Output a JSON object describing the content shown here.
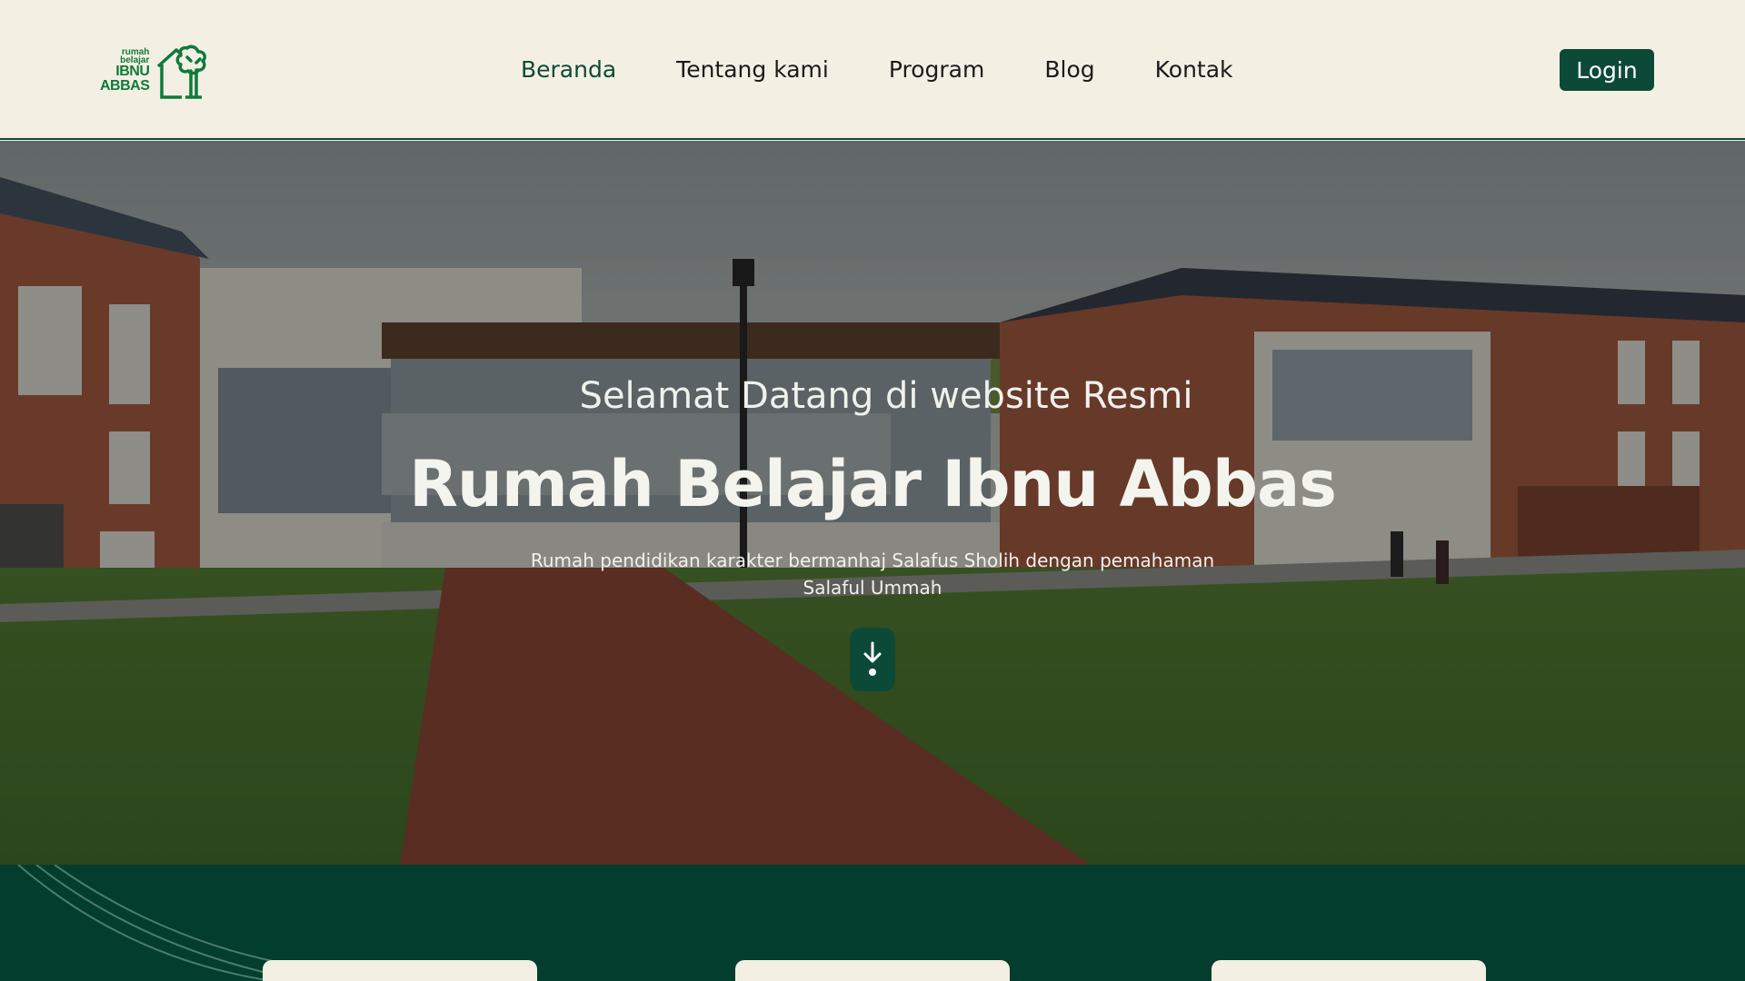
{
  "logo": {
    "line1": "rumah",
    "line2": "belajar",
    "line3": "IBNU",
    "line4": "ABBAS",
    "icon": "tree-house-icon",
    "color": "#0e7a3c"
  },
  "nav": {
    "items": [
      {
        "label": "Beranda",
        "active": true
      },
      {
        "label": "Tentang kami",
        "active": false
      },
      {
        "label": "Program",
        "active": false
      },
      {
        "label": "Blog",
        "active": false
      },
      {
        "label": "Kontak",
        "active": false
      }
    ]
  },
  "login": {
    "label": "Login"
  },
  "hero": {
    "welcome": "Selamat Datang di website Resmi",
    "title": "Rumah Belajar Ibnu Abbas",
    "description": "Rumah pendidikan karakter bermanhaj Salafus Sholih dengan pemahaman Salaful Ummah",
    "scroll_icon": "arrow-down-icon"
  },
  "colors": {
    "primary": "#0c4a37",
    "dark_green": "#033d2d",
    "cream": "#f4efe3"
  }
}
